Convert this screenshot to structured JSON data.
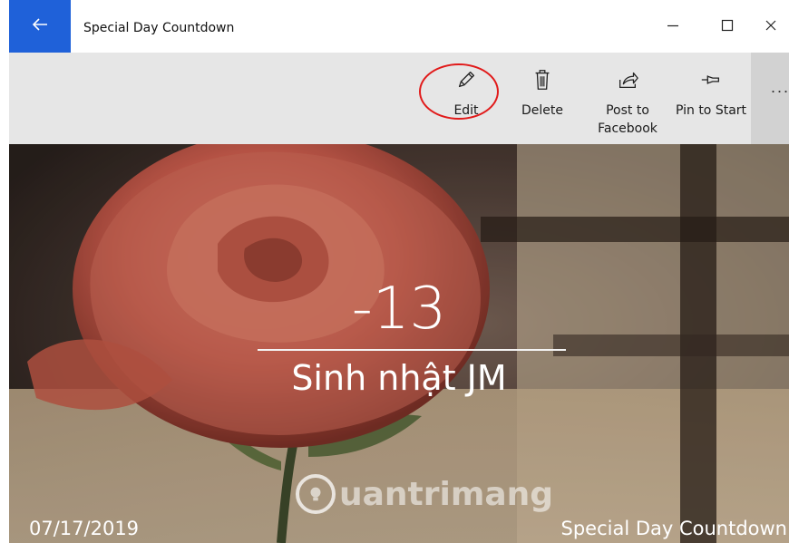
{
  "window": {
    "title": "Special Day Countdown",
    "accent_color": "#1f61d9",
    "back_icon": "arrow-left-icon",
    "minimize_icon": "minimize-icon",
    "maximize_icon": "maximize-icon",
    "close_icon": "close-icon"
  },
  "commandbar": {
    "buttons": [
      {
        "label": "Edit",
        "icon": "pencil-icon"
      },
      {
        "label": "Delete",
        "icon": "trash-icon"
      },
      {
        "label": "Post to\nFacebook",
        "icon": "share-icon"
      },
      {
        "label": "Pin to Start",
        "icon": "pin-icon"
      }
    ],
    "more_label": "...",
    "highlight_color": "#e11a1a"
  },
  "countdown": {
    "days": "-13",
    "event_name": "Sinh nhật JM",
    "date": "07/17/2019",
    "app_name": "Special Day Countdown"
  },
  "watermark": {
    "text": "uantrimang"
  }
}
